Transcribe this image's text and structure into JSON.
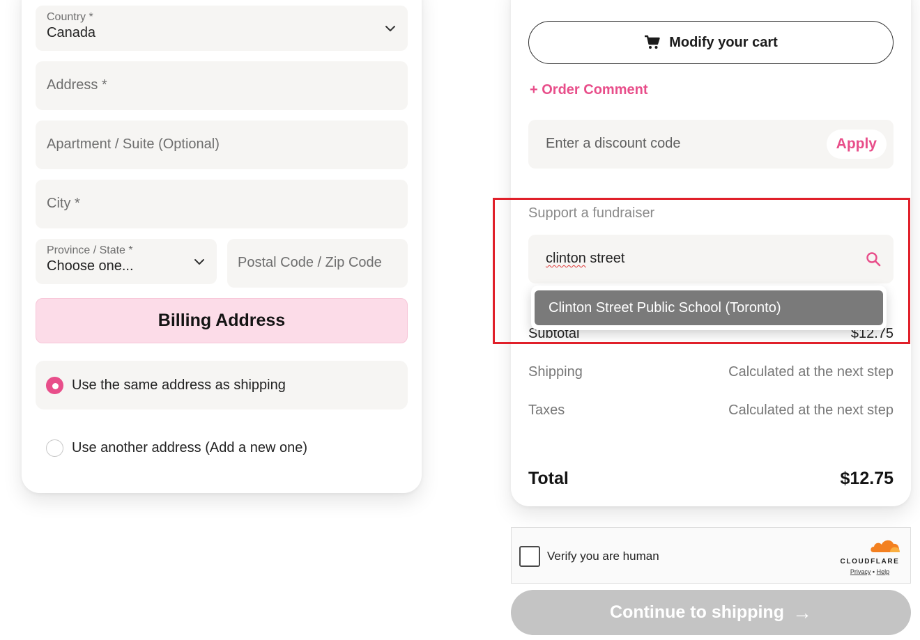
{
  "shipping_form": {
    "country_label": "Country *",
    "country_value": "Canada",
    "address_placeholder": "Address *",
    "apartment_placeholder": "Apartment / Suite (Optional)",
    "city_placeholder": "City *",
    "province_label": "Province / State *",
    "province_value": "Choose one...",
    "postal_placeholder": "Postal Code / Zip Code"
  },
  "billing": {
    "title": "Billing Address",
    "options": [
      {
        "label": "Use the same address as shipping",
        "selected": true
      },
      {
        "label": "Use another address (Add a new one)",
        "selected": false
      }
    ]
  },
  "cart": {
    "modify_label": "Modify your cart",
    "order_comment_label": "Order Comment",
    "discount_placeholder": "Enter a discount code",
    "apply_label": "Apply",
    "fundraiser_label": "Support a fundraiser",
    "fundraiser_value_word1": "clinton",
    "fundraiser_value_word2": "street",
    "fundraiser_suggestion": "Clinton Street Public School (Toronto)",
    "subtotal_label": "Subtotal",
    "subtotal_value": "$12.75",
    "shipping_label": "Shipping",
    "shipping_value": "Calculated at the next step",
    "taxes_label": "Taxes",
    "taxes_value": "Calculated at the next step",
    "total_label": "Total",
    "total_value": "$12.75"
  },
  "captcha": {
    "label": "Verify you are human",
    "brand": "CLOUDFLARE",
    "privacy": "Privacy",
    "separator": "•",
    "help": "Help"
  },
  "continue": {
    "label": "Continue to shipping",
    "arrow": "→"
  },
  "colors": {
    "accent": "#e84e8a",
    "billing_bg": "#fcdce8",
    "field_bg": "#f6f5f3",
    "highlight": "#e0202a",
    "disabled": "#c4c4c4"
  }
}
